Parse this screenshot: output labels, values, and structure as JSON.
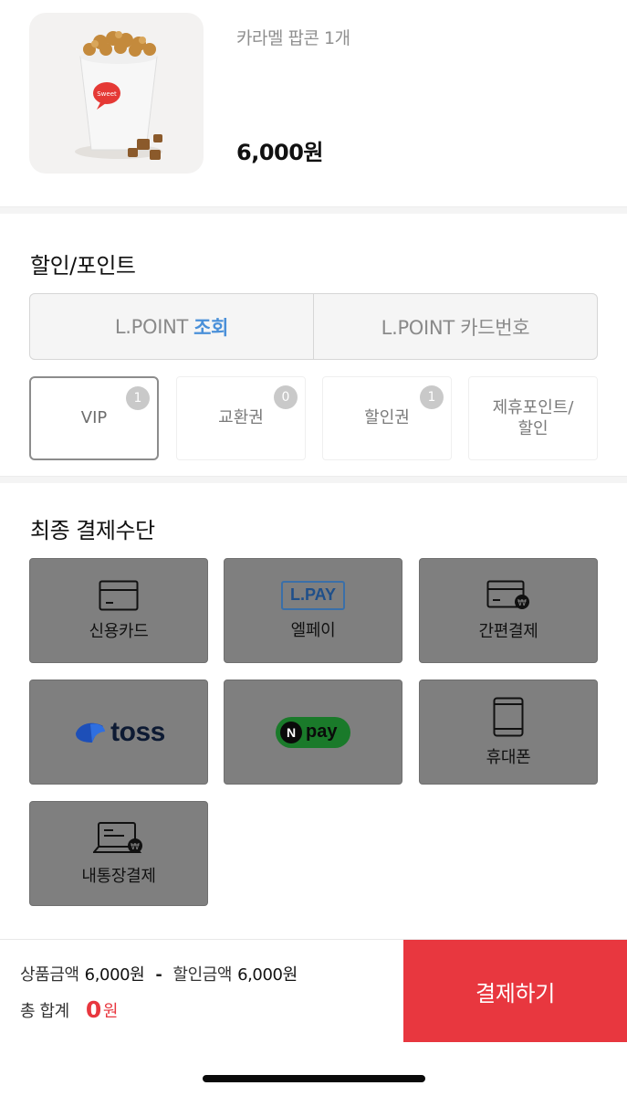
{
  "product": {
    "name": "카라멜 팝콘 1개",
    "price": "6,000원",
    "cup_label": "Sweet"
  },
  "discount": {
    "title": "할인/포인트",
    "lpoint_prefix": "L.POINT",
    "lpoint_lookup": "조회",
    "lpoint_card": "L.POINT 카드번호",
    "cards": [
      {
        "label": "VIP",
        "badge": "1"
      },
      {
        "label": "교환권",
        "badge": "0"
      },
      {
        "label": "할인권",
        "badge": "1"
      },
      {
        "label_line1": "제휴포인트/",
        "label_line2": "할인"
      }
    ]
  },
  "payment": {
    "title": "최종 결제수단",
    "methods": [
      {
        "label": "신용카드",
        "icon": "credit-card-icon"
      },
      {
        "label": "엘페이",
        "icon_text": "L.PAY"
      },
      {
        "label": "간편결제",
        "icon": "card-won-icon"
      },
      {
        "label": "toss",
        "icon": "toss-logo"
      },
      {
        "label": "pay",
        "logo_letter": "N"
      },
      {
        "label": "휴대폰",
        "icon": "mobile-phone-icon"
      },
      {
        "label": "내통장결제",
        "icon": "laptop-won-icon"
      }
    ]
  },
  "footer": {
    "product_amount_label": "상품금액",
    "product_amount": "6,000원",
    "dash": "-",
    "discount_amount_label": "할인금액",
    "discount_amount": "6,000원",
    "total_label": "총 합계",
    "total_value": "0",
    "total_unit": "원",
    "pay_button": "결제하기"
  },
  "colors": {
    "accent_red": "#e8373f",
    "lpoint_blue": "#4a90d9",
    "tile_gray": "#7f7f7f"
  }
}
